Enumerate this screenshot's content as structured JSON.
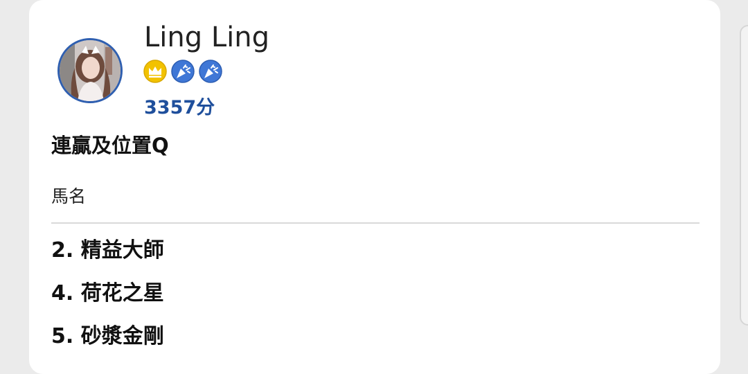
{
  "user": {
    "name": "Ling Ling",
    "points": "3357分",
    "avatar_icon": "user-photo-avatar",
    "badges": [
      {
        "icon": "crown-icon",
        "color": "#f2c200"
      },
      {
        "icon": "party-popper-icon",
        "color": "#3f77d6"
      },
      {
        "icon": "party-popper-icon",
        "color": "#3f77d6"
      }
    ]
  },
  "section": {
    "title": "連贏及位置Q",
    "column_header": "馬名"
  },
  "horses": [
    "2. 精益大師",
    "4. 荷花之星",
    "5. 砂漿金剛"
  ],
  "colors": {
    "accent": "#1f4f9c",
    "avatar_border": "#2f5fb0"
  }
}
